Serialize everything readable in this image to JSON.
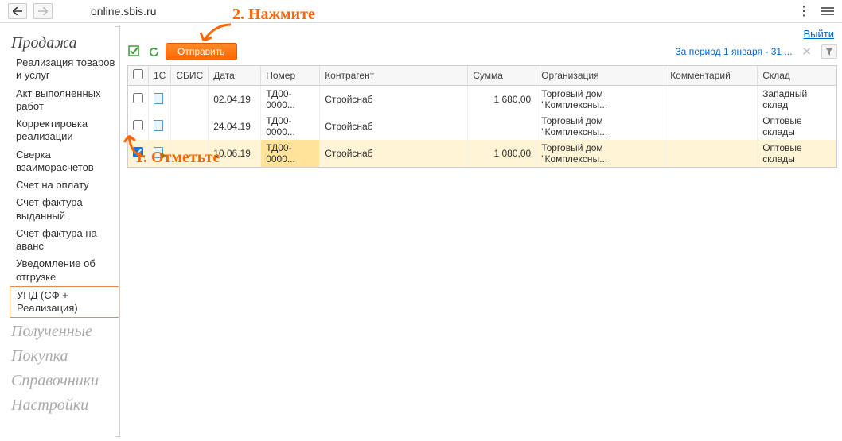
{
  "url": "online.sbis.ru",
  "top_right_link": "Выйти",
  "toolbar": {
    "send_label": "Отправить",
    "period_text": "За период 1 января - 31 ..."
  },
  "sidebar": {
    "sections": {
      "sales": "Продажа",
      "received": "Полученные",
      "purchase": "Покупка",
      "refs": "Справочники",
      "settings": "Настройки"
    },
    "items": [
      "Реализация товаров и услуг",
      "Акт выполненных работ",
      "Корректировка реализации",
      "Сверка взаиморасчетов",
      "Счет на оплату",
      "Счет-фактура выданный",
      "Счет-фактура на аванс",
      "Уведомление об отгрузке",
      "УПД (СФ + Реализация)"
    ]
  },
  "grid": {
    "headers": {
      "c1c": "1С",
      "sbis": "СБИС",
      "date": "Дата",
      "number": "Номер",
      "counter": "Контрагент",
      "sum": "Сумма",
      "org": "Организация",
      "comment": "Комментарий",
      "warehouse": "Склад"
    },
    "rows": [
      {
        "checked": false,
        "sbis_send": false,
        "date": "02.04.19",
        "number": "ТД00-0000...",
        "counter": "Стройснаб",
        "sum": "1 680,00",
        "org": "Торговый дом \"Комплексны...",
        "comment": "",
        "warehouse": "Западный склад"
      },
      {
        "checked": false,
        "sbis_send": false,
        "date": "24.04.19",
        "number": "ТД00-0000...",
        "counter": "Стройснаб",
        "sum": "",
        "org": "Торговый дом \"Комплексны...",
        "comment": "",
        "warehouse": "Оптовые склады"
      },
      {
        "checked": true,
        "sbis_send": true,
        "date": "10.06.19",
        "number": "ТД00-0000...",
        "counter": "Стройснаб",
        "sum": "1 080,00",
        "org": "Торговый дом \"Комплексны...",
        "comment": "",
        "warehouse": "Оптовые склады"
      }
    ]
  },
  "annotations": {
    "step1": "1. Отметьте",
    "step2": "2. Нажмите"
  }
}
